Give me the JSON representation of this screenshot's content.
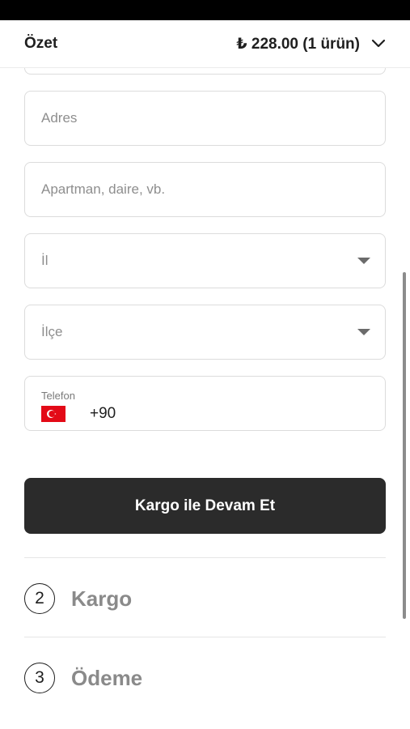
{
  "summary": {
    "title": "Özet",
    "total": "₺ 228.00 (1 ürün)"
  },
  "form": {
    "address_placeholder": "Adres",
    "apartment_placeholder": "Apartman, daire, vb.",
    "province_placeholder": "İl",
    "district_placeholder": "İlçe",
    "phone_label": "Telefon",
    "phone_country_code": "+90"
  },
  "continue_button": {
    "label": "Kargo ile Devam Et"
  },
  "steps": [
    {
      "number": "2",
      "label": "Kargo"
    },
    {
      "number": "3",
      "label": "Ödeme"
    }
  ],
  "colors": {
    "button_bg": "#2b2b2b",
    "flag_red": "#e30a17",
    "step_label": "#8a8a8a"
  },
  "icons": {
    "summary_toggle": "chevron-down-icon",
    "select_caret": "caret-down-icon",
    "flag": "turkey-flag-icon"
  }
}
